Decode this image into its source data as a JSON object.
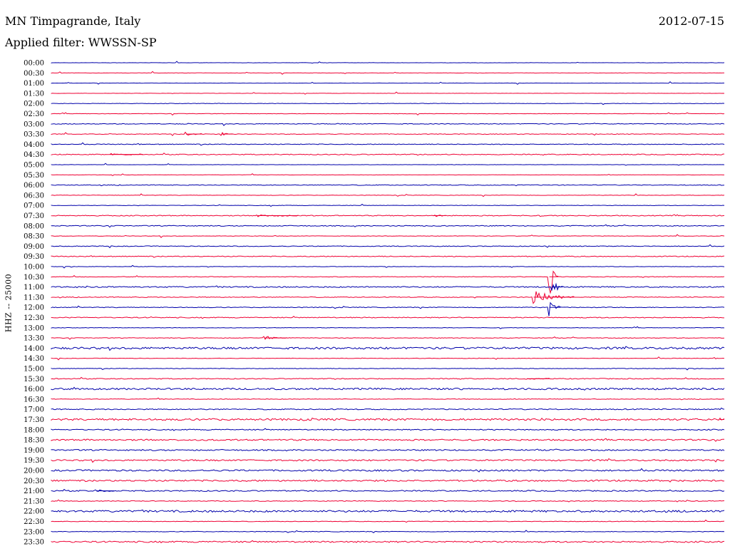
{
  "header": {
    "station": "MN Timpagrande, Italy",
    "filter": "Applied filter: WWSSN-SP",
    "date": "2012-07-15",
    "channel": "HHZ -- 25000"
  },
  "colors": {
    "blue_trace": "#0000aa",
    "red_trace": "#ee0033",
    "background": "#ffffff",
    "text": "#000000"
  },
  "chart_data": {
    "type": "line",
    "title": "MN Timpagrande, Italy",
    "subtitle": "Applied filter: WWSSN-SP",
    "date": "2012-07-15",
    "ylabel": "HHZ -- 25000",
    "xlabel": "",
    "trace_colors": [
      "#0000aa",
      "#ee0033"
    ],
    "x_range_minutes": [
      0,
      30
    ],
    "rows": [
      {
        "time": "00:00",
        "noise": 0.2
      },
      {
        "time": "00:30",
        "noise": 0.2
      },
      {
        "time": "01:00",
        "noise": 0.2
      },
      {
        "time": "01:30",
        "noise": 0.2
      },
      {
        "time": "02:00",
        "noise": 0.3
      },
      {
        "time": "02:30",
        "noise": 0.3
      },
      {
        "time": "03:00",
        "noise": 0.5
      },
      {
        "time": "03:30",
        "noise": 0.4
      },
      {
        "time": "04:00",
        "noise": 0.5
      },
      {
        "time": "04:30",
        "noise": 0.6
      },
      {
        "time": "05:00",
        "noise": 0.2
      },
      {
        "time": "05:30",
        "noise": 0.2
      },
      {
        "time": "06:00",
        "noise": 0.5
      },
      {
        "time": "06:30",
        "noise": 0.3
      },
      {
        "time": "07:00",
        "noise": 0.3
      },
      {
        "time": "07:30",
        "noise": 0.6
      },
      {
        "time": "08:00",
        "noise": 0.6
      },
      {
        "time": "08:30",
        "noise": 0.3
      },
      {
        "time": "09:00",
        "noise": 0.5
      },
      {
        "time": "09:30",
        "noise": 0.6
      },
      {
        "time": "10:00",
        "noise": 0.3
      },
      {
        "time": "10:30",
        "noise": 0.4
      },
      {
        "time": "11:00",
        "noise": 0.8
      },
      {
        "time": "11:30",
        "noise": 0.5
      },
      {
        "time": "12:00",
        "noise": 0.5
      },
      {
        "time": "12:30",
        "noise": 0.6
      },
      {
        "time": "13:00",
        "noise": 0.3
      },
      {
        "time": "13:30",
        "noise": 0.4
      },
      {
        "time": "14:00",
        "noise": 1.4
      },
      {
        "time": "14:30",
        "noise": 0.3
      },
      {
        "time": "15:00",
        "noise": 0.4
      },
      {
        "time": "15:30",
        "noise": 0.6
      },
      {
        "time": "16:00",
        "noise": 1.2
      },
      {
        "time": "16:30",
        "noise": 0.4
      },
      {
        "time": "17:00",
        "noise": 0.7
      },
      {
        "time": "17:30",
        "noise": 1.3
      },
      {
        "time": "18:00",
        "noise": 0.7
      },
      {
        "time": "18:30",
        "noise": 1.0
      },
      {
        "time": "19:00",
        "noise": 0.9
      },
      {
        "time": "19:30",
        "noise": 1.0
      },
      {
        "time": "20:00",
        "noise": 1.1
      },
      {
        "time": "20:30",
        "noise": 1.1
      },
      {
        "time": "21:00",
        "noise": 0.8
      },
      {
        "time": "21:30",
        "noise": 0.5
      },
      {
        "time": "22:00",
        "noise": 1.3
      },
      {
        "time": "22:30",
        "noise": 0.4
      },
      {
        "time": "23:00",
        "noise": 0.4
      },
      {
        "time": "23:30",
        "noise": 1.0
      }
    ],
    "events": [
      {
        "row": 7,
        "minute": 6.0,
        "duration": 0.7,
        "amplitude": 3
      },
      {
        "row": 7,
        "minute": 7.6,
        "duration": 0.5,
        "amplitude": 3
      },
      {
        "row": 9,
        "minute": 2.6,
        "duration": 1.5,
        "amplitude": 1.5
      },
      {
        "row": 15,
        "minute": 9.2,
        "duration": 1.8,
        "amplitude": 1.5
      },
      {
        "row": 15,
        "minute": 17.0,
        "duration": 0.6,
        "amplitude": 2
      },
      {
        "row": 21,
        "minute": 22.2,
        "duration": 0.4,
        "amplitude": 55
      },
      {
        "row": 22,
        "minute": 22.3,
        "duration": 0.5,
        "amplitude": 20
      },
      {
        "row": 23,
        "minute": 21.5,
        "duration": 1.8,
        "amplitude": 14
      },
      {
        "row": 24,
        "minute": 22.2,
        "duration": 0.5,
        "amplitude": 22
      },
      {
        "row": 27,
        "minute": 9.5,
        "duration": 1.0,
        "amplitude": 3
      },
      {
        "row": 31,
        "minute": 21.2,
        "duration": 1.0,
        "amplitude": 1.5
      },
      {
        "row": 35,
        "minute": 29.8,
        "duration": 0.2,
        "amplitude": 3
      },
      {
        "row": 42,
        "minute": 2.0,
        "duration": 0.8,
        "amplitude": 2
      }
    ]
  }
}
